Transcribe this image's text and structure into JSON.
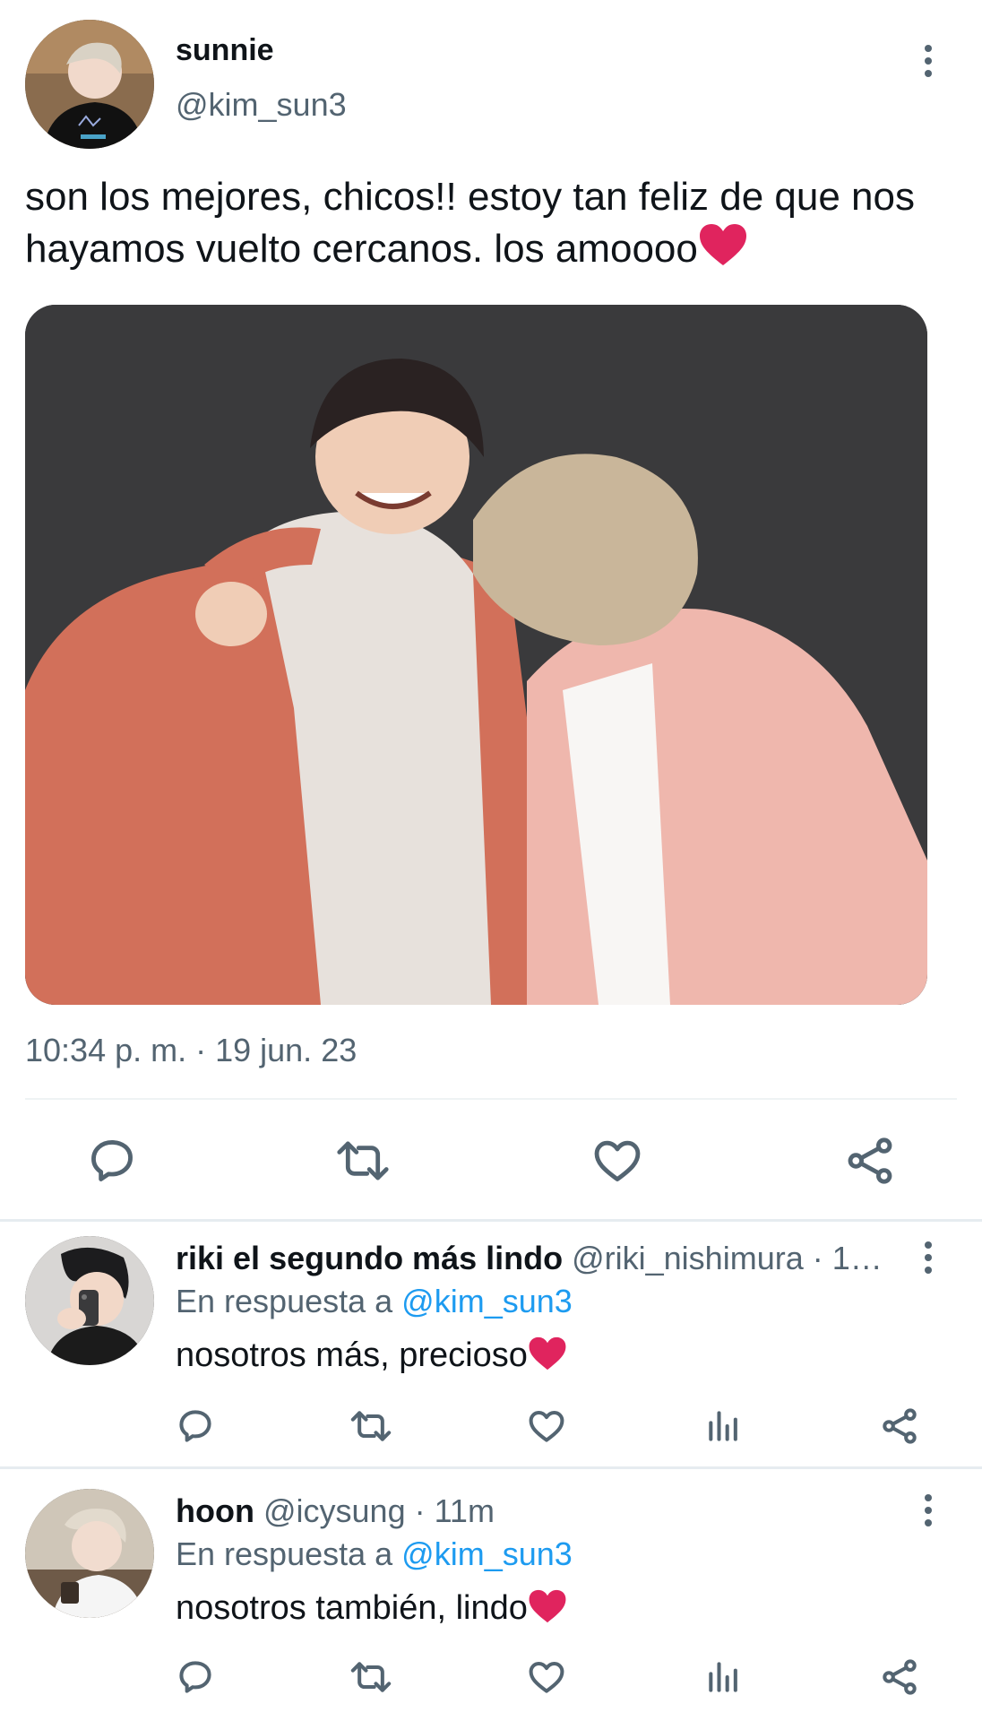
{
  "main_tweet": {
    "display_name": "sunnie",
    "handle": "@kim_sun3",
    "text": "son los mejores, chicos!! estoy tan feliz de que nos hayamos vuelto cercanos. los amoooo",
    "text_emoji": "❤️",
    "timestamp": "10:34 p. m. · 19 jun. 23",
    "media_alt": "photo-two-people-hugging",
    "actions": [
      "reply-icon",
      "retweet-icon",
      "like-icon",
      "share-icon"
    ]
  },
  "replies": [
    {
      "display_name": "riki el segundo más lindo",
      "meta": "@riki_nishimura · 1…",
      "reply_prefix": "En respuesta a",
      "reply_to": "@kim_sun3",
      "text": "nosotros más, precioso",
      "text_emoji": "❤️"
    },
    {
      "display_name": "hoon",
      "meta": "@icysung · 11m",
      "reply_prefix": "En respuesta a",
      "reply_to": "@kim_sun3",
      "text": "nosotros también, lindo",
      "text_emoji": "❤️"
    }
  ],
  "colors": {
    "text_primary": "#0f1419",
    "text_secondary": "#536471",
    "link_blue": "#1d9bf0",
    "heart_red": "#e0245e"
  }
}
